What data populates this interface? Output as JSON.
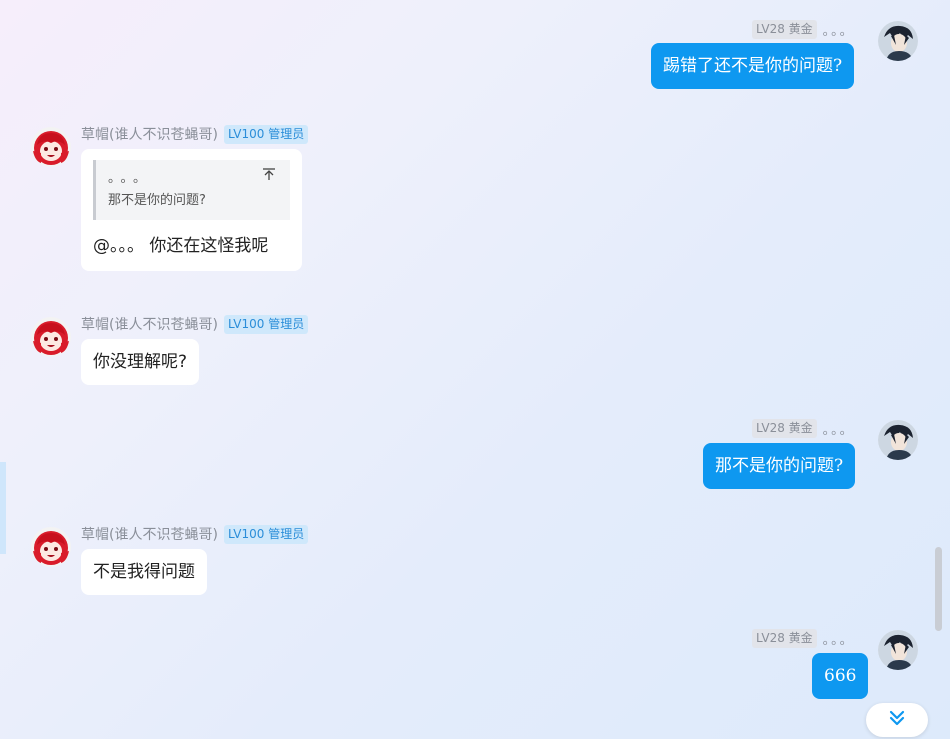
{
  "users": {
    "admin": {
      "name": "草帽(谁人不识苍蝇哥)",
      "badge": "LV100 管理员"
    },
    "me": {
      "badge": "LV28 黄金",
      "name": "。。。"
    }
  },
  "messages": [
    {
      "id": "m1",
      "side": "right",
      "text": "踢错了还不是你的问题?"
    },
    {
      "id": "m2",
      "side": "left",
      "quote": {
        "author": "。。。",
        "text": "那不是你的问题?"
      },
      "text": "@。。。 你还在这怪我呢"
    },
    {
      "id": "m3",
      "side": "left",
      "text": "你没理解呢?"
    },
    {
      "id": "m4",
      "side": "right",
      "text": "那不是你的问题?"
    },
    {
      "id": "m5",
      "side": "left",
      "text": "不是我得问题"
    },
    {
      "id": "m6",
      "side": "right",
      "text": "666"
    }
  ],
  "icons": {
    "quote_jump": "arrow-to-top-icon",
    "scroll_down": "double-chevron-down-icon"
  },
  "colors": {
    "my_bubble": "#0e98f0",
    "other_bubble": "#ffffff",
    "admin_badge_bg": "#cfe8fb",
    "admin_badge_text": "#2b8ed9"
  }
}
